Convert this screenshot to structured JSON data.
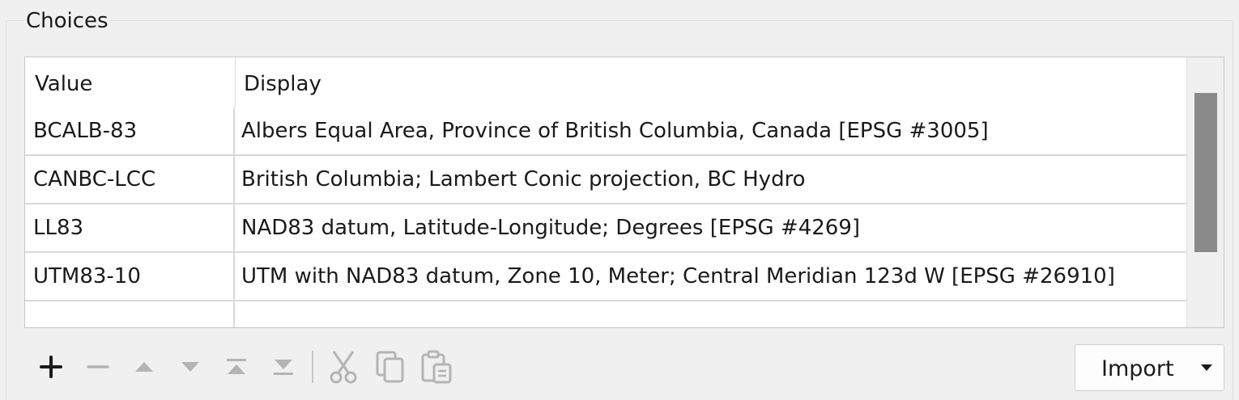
{
  "group": {
    "title": "Choices"
  },
  "table": {
    "columns": [
      "Value",
      "Display"
    ],
    "rows": [
      {
        "value": "BCALB-83",
        "display": "Albers Equal Area, Province of British Columbia, Canada [EPSG #3005]"
      },
      {
        "value": "CANBC-LCC",
        "display": "British Columbia; Lambert Conic projection, BC Hydro"
      },
      {
        "value": "LL83",
        "display": "NAD83 datum, Latitude-Longitude; Degrees [EPSG #4269]"
      },
      {
        "value": "UTM83-10",
        "display": "UTM with NAD83 datum, Zone 10, Meter; Central Meridian 123d W [EPSG #26910]"
      }
    ]
  },
  "toolbar": {
    "icons": [
      "plus-icon",
      "minus-icon",
      "move-up-icon",
      "move-down-icon",
      "move-top-icon",
      "move-bottom-icon",
      "cut-icon",
      "copy-icon",
      "paste-icon"
    ]
  },
  "import_button": {
    "label": "Import"
  },
  "colors": {
    "background": "#f0f0f0",
    "scroll_thumb": "#8a8a8a",
    "disabled_icon": "#b4b4b4",
    "active_icon": "#1a1a1a"
  }
}
